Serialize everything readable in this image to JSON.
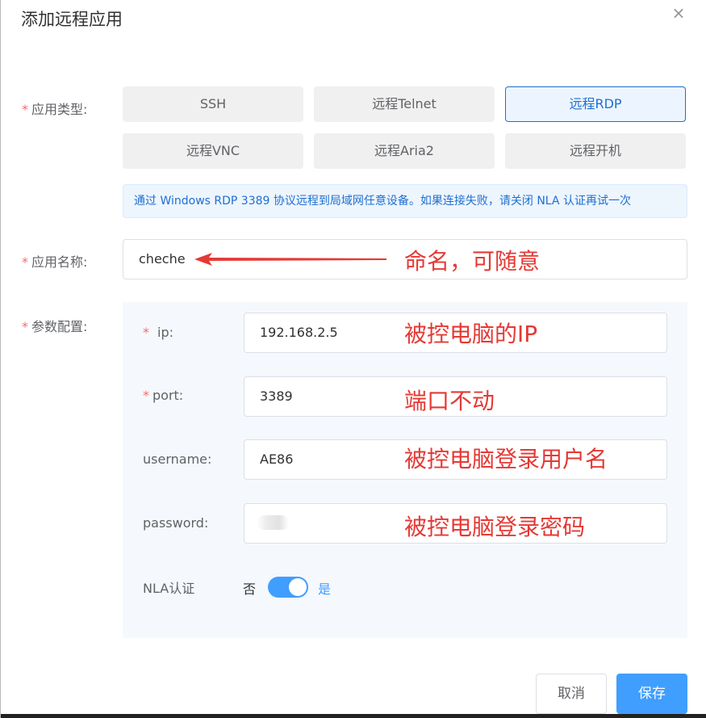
{
  "dialog": {
    "title": "添加远程应用",
    "close_glyph": "×"
  },
  "form": {
    "type_label": "应用类型:",
    "name_label": "应用名称:",
    "params_label": "参数配置:",
    "required_mark": "*",
    "types": [
      {
        "label": "SSH",
        "selected": false
      },
      {
        "label": "远程Telnet",
        "selected": false
      },
      {
        "label": "远程RDP",
        "selected": true
      },
      {
        "label": "远程VNC",
        "selected": false
      },
      {
        "label": "远程Aria2",
        "selected": false
      },
      {
        "label": "远程开机",
        "selected": false
      }
    ],
    "hint": "通过 Windows RDP 3389 协议远程到局域网任意设备。如果连接失败，请关闭 NLA 认证再试一次",
    "name_value": "cheche",
    "params": {
      "ip_label": "ip:",
      "ip_value": "192.168.2.5",
      "port_label": "port:",
      "port_value": "3389",
      "username_label": "username:",
      "username_value": "AE86",
      "password_label": "password:",
      "nla_label": "NLA认证",
      "nla_off": "否",
      "nla_on": "是",
      "nla_enabled": true
    }
  },
  "annotations": {
    "name": "命名，可随意",
    "ip": "被控电脑的IP",
    "port": "端口不动",
    "username": "被控电脑登录用户名",
    "password": "被控电脑登录密码",
    "color": "#e53935"
  },
  "footer": {
    "cancel": "取消",
    "save": "保存"
  },
  "colors": {
    "accent": "#409eff",
    "selected_border": "#1f6fd1",
    "required": "#f56c6c"
  }
}
